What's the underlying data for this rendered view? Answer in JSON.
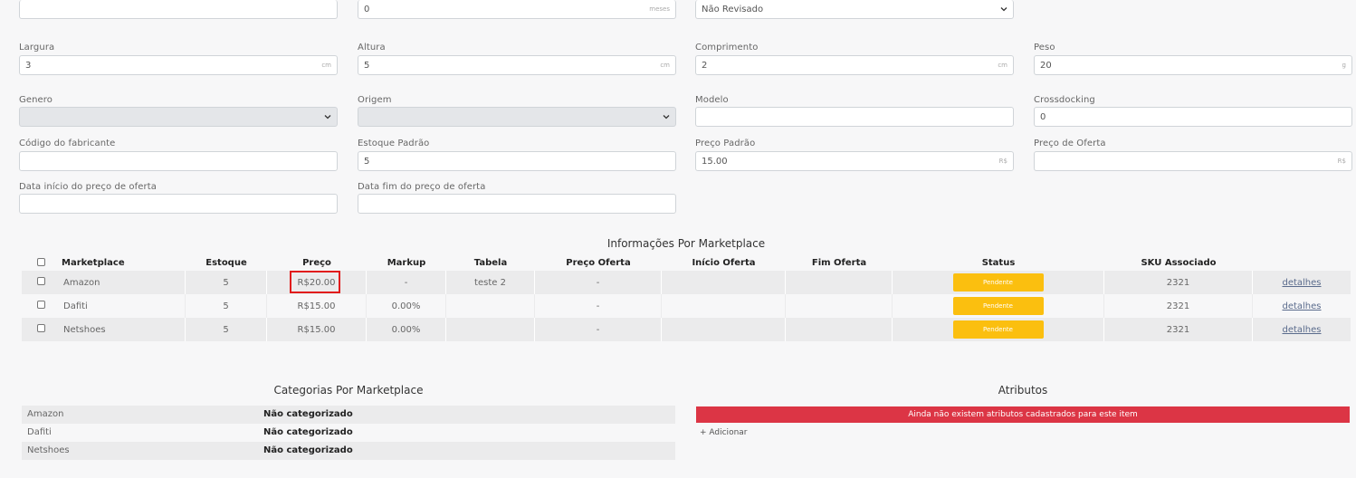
{
  "form": {
    "row0": {
      "field1_value": "",
      "field2_value": "0",
      "field2_suffix": "meses",
      "field3_value": "Não Revisado"
    },
    "largura": {
      "label": "Largura",
      "value": "3",
      "suffix": "cm"
    },
    "altura": {
      "label": "Altura",
      "value": "5",
      "suffix": "cm"
    },
    "comprimento": {
      "label": "Comprimento",
      "value": "2",
      "suffix": "cm"
    },
    "peso": {
      "label": "Peso",
      "value": "20",
      "suffix": "g"
    },
    "genero": {
      "label": "Genero",
      "value": ""
    },
    "origem": {
      "label": "Origem",
      "value": ""
    },
    "modelo": {
      "label": "Modelo",
      "value": ""
    },
    "crossdocking": {
      "label": "Crossdocking",
      "value": "0"
    },
    "codigo": {
      "label": "Código do fabricante",
      "value": ""
    },
    "estoque": {
      "label": "Estoque Padrão",
      "value": "5"
    },
    "preco_padrao": {
      "label": "Preço Padrão",
      "value": "15.00",
      "suffix": "R$"
    },
    "preco_oferta": {
      "label": "Preço de Oferta",
      "value": "",
      "suffix": "R$"
    },
    "data_inicio": {
      "label": "Data início do preço de oferta",
      "value": ""
    },
    "data_fim": {
      "label": "Data fim do preço de oferta",
      "value": ""
    }
  },
  "marketplace": {
    "title": "Informações Por Marketplace",
    "headers": [
      "Marketplace",
      "Estoque",
      "Preço",
      "Markup",
      "Tabela",
      "Preço Oferta",
      "Início Oferta",
      "Fim Oferta",
      "Status",
      "SKU Associado"
    ],
    "rows": [
      {
        "marketplace": "Amazon",
        "estoque": "5",
        "preco": "R$20.00",
        "markup": "-",
        "tabela": "teste 2",
        "preco_oferta": "-",
        "inicio": "",
        "fim": "",
        "status": "Pendente",
        "sku": "2321",
        "link": "detalhes"
      },
      {
        "marketplace": "Dafiti",
        "estoque": "5",
        "preco": "R$15.00",
        "markup": "0.00%",
        "tabela": "",
        "preco_oferta": "-",
        "inicio": "",
        "fim": "",
        "status": "Pendente",
        "sku": "2321",
        "link": "detalhes"
      },
      {
        "marketplace": "Netshoes",
        "estoque": "5",
        "preco": "R$15.00",
        "markup": "0.00%",
        "tabela": "",
        "preco_oferta": "-",
        "inicio": "",
        "fim": "",
        "status": "Pendente",
        "sku": "2321",
        "link": "detalhes"
      }
    ]
  },
  "categorias": {
    "title": "Categorias Por Marketplace",
    "rows": [
      {
        "marketplace": "Amazon",
        "value": "Não categorizado"
      },
      {
        "marketplace": "Dafiti",
        "value": "Não categorizado"
      },
      {
        "marketplace": "Netshoes",
        "value": "Não categorizado"
      }
    ]
  },
  "atributos": {
    "title": "Atributos",
    "alert": "Ainda não existem atributos cadastrados para este item",
    "add_label": "+ Adicionar"
  },
  "colors": {
    "status_pending": "#fbbf0f",
    "alert": "#dc3545",
    "highlight": "#e11c1c"
  }
}
